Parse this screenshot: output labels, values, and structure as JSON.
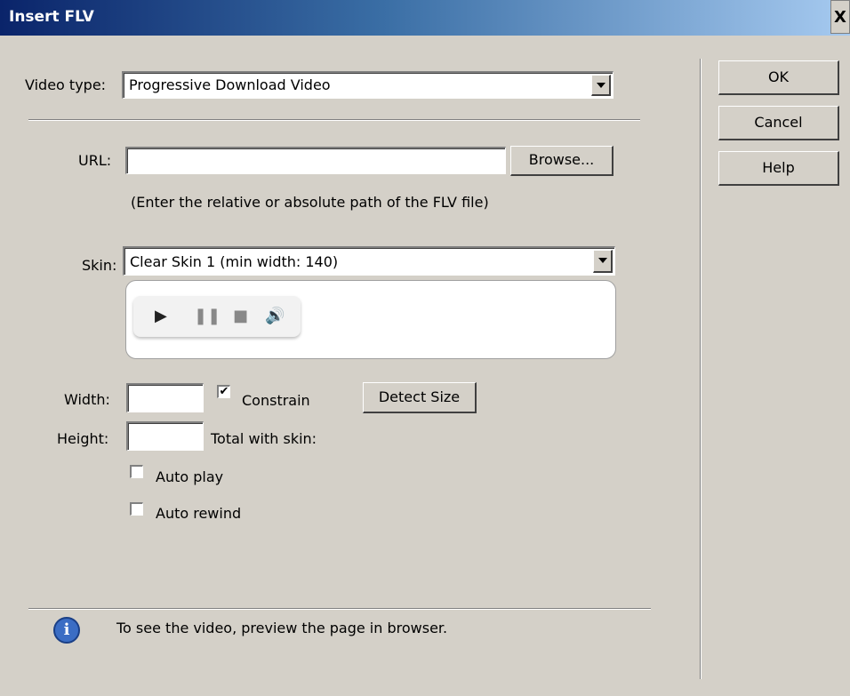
{
  "window": {
    "title": "Insert FLV",
    "close_glyph": "X"
  },
  "video_type": {
    "label": "Video type:",
    "value": "Progressive Download Video"
  },
  "url": {
    "label": "URL:",
    "value": "",
    "browse_label": "Browse...",
    "hint": "(Enter the relative or absolute path of the FLV file)"
  },
  "skin": {
    "label": "Skin:",
    "value": "Clear Skin 1 (min width: 140)"
  },
  "size": {
    "width_label": "Width:",
    "width_value": "",
    "height_label": "Height:",
    "height_value": "",
    "constrain_label": "Constrain",
    "constrain_checked": true,
    "detect_label": "Detect Size",
    "total_label": "Total with skin:"
  },
  "options": {
    "autoplay_label": "Auto play",
    "autoplay_checked": false,
    "autorewind_label": "Auto rewind",
    "autorewind_checked": false
  },
  "info": {
    "text": "To see the video, preview the page in browser.",
    "icon": "info-icon"
  },
  "buttons": {
    "ok": "OK",
    "cancel": "Cancel",
    "help": "Help"
  }
}
